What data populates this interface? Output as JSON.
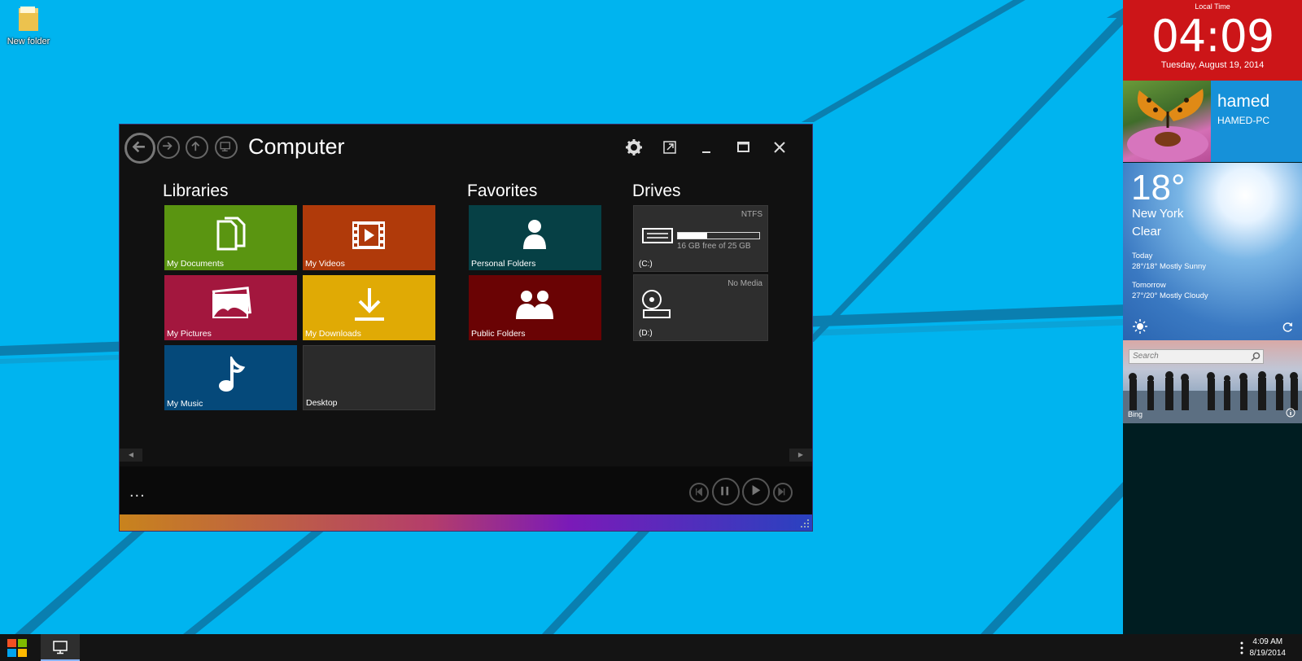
{
  "desktop": {
    "icon_label": "New folder"
  },
  "window": {
    "title": "Computer",
    "sections": {
      "libraries": "Libraries",
      "favorites": "Favorites",
      "drives": "Drives"
    },
    "libraries": [
      {
        "label": "My Documents",
        "color": "#5a9511"
      },
      {
        "label": "My Videos",
        "color": "#b03a0a"
      },
      {
        "label": "My Pictures",
        "color": "#a3173e"
      },
      {
        "label": "My Downloads",
        "color": "#e0aa05"
      },
      {
        "label": "My Music",
        "color": "#05497a"
      },
      {
        "label": "Desktop",
        "color": "#2b2b2b"
      }
    ],
    "favorites": [
      {
        "label": "Personal Folders",
        "color": "#064045"
      },
      {
        "label": "Public Folders",
        "color": "#6a0304"
      }
    ],
    "drives": [
      {
        "label": "(C:)",
        "fs": "NTFS",
        "free_text": "16 GB free of 25 GB",
        "used_fraction": 0.36
      },
      {
        "label": "(D:)",
        "fs": "No Media"
      }
    ],
    "more_label": "..."
  },
  "panel": {
    "clock": {
      "caption": "Local Time",
      "time": "04:09",
      "date": "Tuesday, August 19, 2014"
    },
    "user": {
      "name": "hamed",
      "pc": "HAMED-PC"
    },
    "weather": {
      "temp": "18°",
      "city": "New York",
      "condition": "Clear",
      "today_label": "Today",
      "today": "28°/18° Mostly Sunny",
      "tomorrow_label": "Tomorrow",
      "tomorrow": "27°/20° Mostly Cloudy"
    },
    "bing": {
      "search_placeholder": "Search",
      "label": "Bing"
    }
  },
  "taskbar": {
    "time": "4:09 AM",
    "date": "8/19/2014"
  }
}
